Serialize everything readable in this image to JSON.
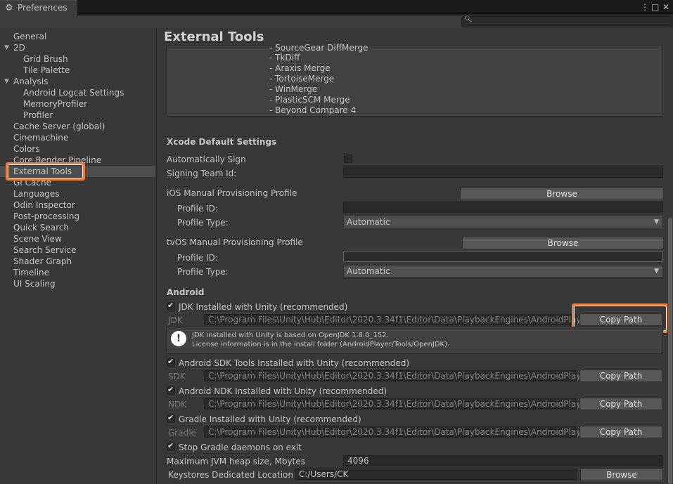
{
  "window": {
    "title": "Preferences",
    "menu_icon": "⋮",
    "maximize_icon": "□",
    "close_icon": "✕"
  },
  "sidebar": {
    "items": [
      {
        "label": "General"
      },
      {
        "label": "2D"
      },
      {
        "label": "Grid Brush"
      },
      {
        "label": "Tile Palette"
      },
      {
        "label": "Analysis"
      },
      {
        "label": "Android Logcat Settings"
      },
      {
        "label": "MemoryProfiler"
      },
      {
        "label": "Profiler"
      },
      {
        "label": "Cache Server (global)"
      },
      {
        "label": "Cinemachine"
      },
      {
        "label": "Colors"
      },
      {
        "label": "Core Render Pipeline"
      },
      {
        "label": "External Tools"
      },
      {
        "label": "GI Cache"
      },
      {
        "label": "Languages"
      },
      {
        "label": "Odin Inspector"
      },
      {
        "label": "Post-processing"
      },
      {
        "label": "Quick Search"
      },
      {
        "label": "Scene View"
      },
      {
        "label": "Search Service"
      },
      {
        "label": "Shader Graph"
      },
      {
        "label": "Timeline"
      },
      {
        "label": "UI Scaling"
      }
    ]
  },
  "main": {
    "title": "External Tools",
    "diff_tools": [
      "- SourceGear DiffMerge",
      "- TkDiff",
      "- Araxis Merge",
      "- TortoiseMerge",
      "- WinMerge",
      "- PlasticSCM Merge",
      "- Beyond Compare 4"
    ],
    "xcode": {
      "header": "Xcode Default Settings",
      "auto_sign_label": "Automatically Sign",
      "signing_team_label": "Signing Team Id:",
      "ios_profile_label": "iOS Manual Provisioning Profile",
      "tvos_profile_label": "tvOS Manual Provisioning Profile",
      "browse_label": "Browse",
      "profile_id_label": "Profile ID:",
      "profile_type_label": "Profile Type:",
      "profile_type_value": "Automatic"
    },
    "android": {
      "header": "Android",
      "jdk_check_label": "JDK Installed with Unity (recommended)",
      "jdk_label": "JDK",
      "jdk_path": "C:\\Program Files\\Unity\\Hub\\Editor\\2020.3.34f1\\Editor\\Data\\PlaybackEngines\\AndroidPlayer\\",
      "copy_path_label": "Copy Path",
      "help_line1": "JDK installed with Unity is based on OpenJDK 1.8.0_152.",
      "help_line2": "License information is in the install folder (AndroidPlayer/Tools/OpenJDK).",
      "sdk_check_label": "Android SDK Tools Installed with Unity (recommended)",
      "sdk_label": "SDK",
      "sdk_path": "C:\\Program Files\\Unity\\Hub\\Editor\\2020.3.34f1\\Editor\\Data\\PlaybackEngines\\AndroidPlayer\\S",
      "ndk_check_label": "Android NDK Installed with Unity (recommended)",
      "ndk_label": "NDK",
      "ndk_path": "C:\\Program Files\\Unity\\Hub\\Editor\\2020.3.34f1\\Editor\\Data\\PlaybackEngines\\AndroidPlayer\\N",
      "gradle_check_label": "Gradle Installed with Unity (recommended)",
      "gradle_label": "Gradle",
      "gradle_path": "C:\\Program Files\\Unity\\Hub\\Editor\\2020.3.34f1\\Editor\\Data\\PlaybackEngines\\AndroidPlayer\\T",
      "stop_gradle_label": "Stop Gradle daemons on exit",
      "jvm_heap_label": "Maximum JVM heap size, Mbytes",
      "jvm_heap_value": "4096",
      "keystores_label": "Keystores Dedicated Location",
      "keystores_value": "C:/Users/CK",
      "browse_label": "Browse"
    }
  },
  "colors": {
    "highlight": "#ee7b3c"
  }
}
